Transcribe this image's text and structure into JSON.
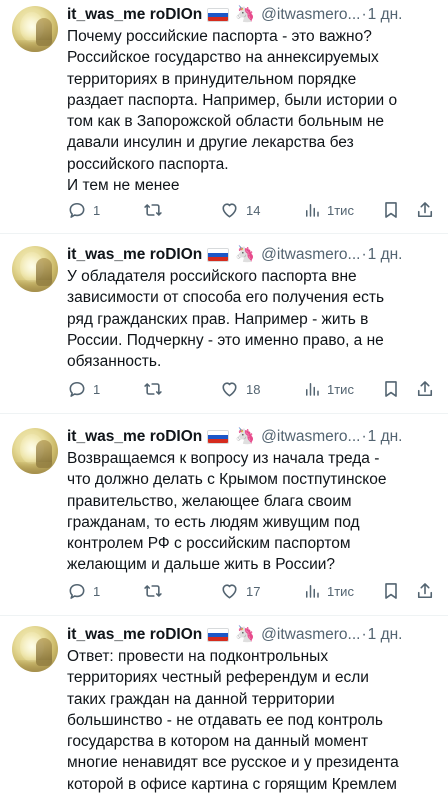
{
  "tweets": [
    {
      "name": "it_was_me roDIOn",
      "handle": "@itwasmero...",
      "dot": "·",
      "time": "1 дн.",
      "lines": [
        "Почему российские паспорта - это важно?",
        "Российское государство на аннексируемых",
        "территориях в принудительном порядке",
        "раздает паспорта. Например, были истории о",
        "том как в Запорожской области больным не",
        "давали инсулин и другие лекарства без",
        "российского паспорта.",
        "И тем не менее"
      ],
      "replies": "1",
      "retweets": "",
      "likes": "14",
      "views": "1тис"
    },
    {
      "name": "it_was_me roDIOn",
      "handle": "@itwasmero...",
      "dot": "·",
      "time": "1 дн.",
      "lines": [
        "У обладателя российского паспорта вне",
        "зависимости от способа его получения есть",
        "ряд гражданских прав. Например - жить в",
        "России. Подчеркну - это именно право, а не",
        "обязанность."
      ],
      "replies": "1",
      "retweets": "",
      "likes": "18",
      "views": "1тис"
    },
    {
      "name": "it_was_me roDIOn",
      "handle": "@itwasmero...",
      "dot": "·",
      "time": "1 дн.",
      "lines": [
        "Возвращаемся к вопросу из начала треда -",
        "что должно делать с Крымом постпутинское",
        "правительство, желающее блага своим",
        "гражданам, то есть людям живущим под",
        "контролем РФ с российским паспортом",
        "желающим и дальше жить в России?"
      ],
      "replies": "1",
      "retweets": "",
      "likes": "17",
      "views": "1тис"
    },
    {
      "name": "it_was_me roDIOn",
      "handle": "@itwasmero...",
      "dot": "·",
      "time": "1 дн.",
      "lines": [
        "Ответ: провести на подконтрольных",
        "территориях честный референдум и если",
        "таких граждан на данной территории",
        "большинство - не отдавать ее под контроль",
        "государства в котором на данный момент",
        "многие ненавидят все русское и у президента",
        "которой в офисе картина с горящим Кремлем"
      ]
    }
  ],
  "flag_colors": [
    "#ffffff",
    "#1c57c8",
    "#d52b1e"
  ],
  "unicorn_emoji": "🦄",
  "icons": {
    "reply": "speech-bubble-icon",
    "retweet": "retweet-arrows-icon",
    "like": "heart-icon",
    "views": "bar-chart-icon",
    "bookmark": "bookmark-icon",
    "share": "share-upload-icon"
  },
  "colors": {
    "text": "#0f1419",
    "muted": "#536471",
    "divider": "#eff3f4"
  }
}
